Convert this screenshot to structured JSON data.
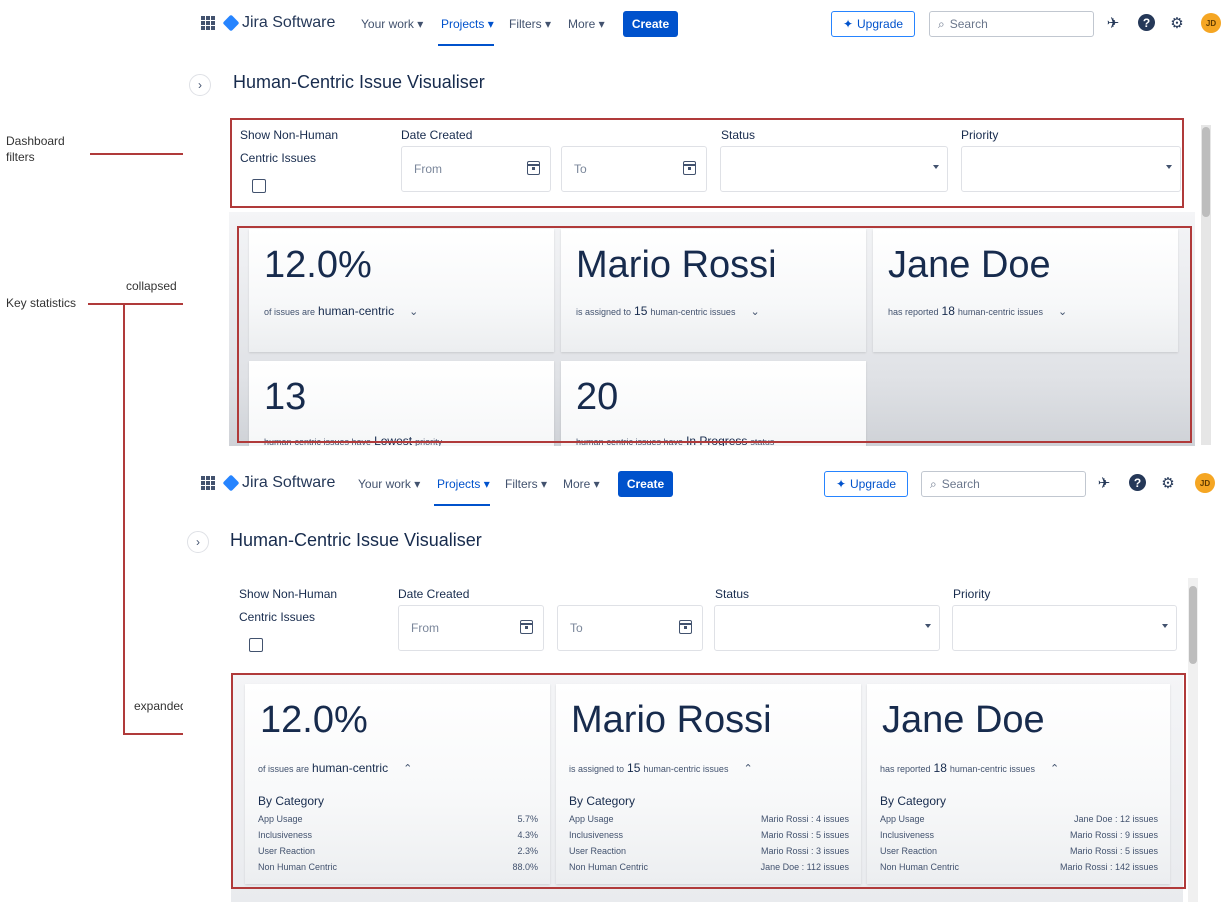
{
  "annotations": {
    "dashboard_filters": [
      "Dashboard",
      "filters"
    ],
    "key_statistics": "Key statistics",
    "collapsed": "collapsed",
    "expanded": "expanded"
  },
  "nav": {
    "product": "Jira Software",
    "items": [
      "Your work",
      "Projects",
      "Filters",
      "More"
    ],
    "create": "Create",
    "upgrade": "Upgrade",
    "search_placeholder": "Search",
    "avatar_initials": "JD"
  },
  "page": {
    "title": "Human-Centric Issue Visualiser"
  },
  "filters": {
    "non_human_label": [
      "Show Non-Human",
      "Centric Issues"
    ],
    "date_label": "Date Created",
    "from": "From",
    "to": "To",
    "status_label": "Status",
    "priority_label": "Priority"
  },
  "collapsed_cards": [
    {
      "big": "12.0%",
      "pre": "of issues are",
      "em": "human-centric",
      "post": ""
    },
    {
      "big": "Mario Rossi",
      "pre": "is assigned to",
      "em": "15",
      "post": "human-centric issues"
    },
    {
      "big": "Jane Doe",
      "pre": "has reported",
      "em": "18",
      "post": "human-centric issues"
    },
    {
      "big": "13",
      "pre": "human-centric issues have",
      "em": "Lowest",
      "post": "priority"
    },
    {
      "big": "20",
      "pre": "human-centric issues have",
      "em": "In Progress",
      "post": "status"
    }
  ],
  "expanded_cards": [
    {
      "big": "12.0%",
      "pre": "of issues are",
      "em": "human-centric",
      "post": "",
      "by_category": "By Category",
      "rows": [
        {
          "label": "App Usage",
          "value": "5.7%"
        },
        {
          "label": "Inclusiveness",
          "value": "4.3%"
        },
        {
          "label": "User Reaction",
          "value": "2.3%"
        },
        {
          "label": "Non Human Centric",
          "value": "88.0%"
        }
      ]
    },
    {
      "big": "Mario Rossi",
      "pre": "is assigned to",
      "em": "15",
      "post": "human-centric issues",
      "by_category": "By Category",
      "rows": [
        {
          "label": "App Usage",
          "value": "Mario Rossi : 4 issues"
        },
        {
          "label": "Inclusiveness",
          "value": "Mario Rossi : 5 issues"
        },
        {
          "label": "User Reaction",
          "value": "Mario Rossi : 3 issues"
        },
        {
          "label": "Non Human Centric",
          "value": "Jane Doe : 112 issues"
        }
      ]
    },
    {
      "big": "Jane Doe",
      "pre": "has reported",
      "em": "18",
      "post": "human-centric issues",
      "by_category": "By Category",
      "rows": [
        {
          "label": "App Usage",
          "value": "Jane Doe : 12 issues"
        },
        {
          "label": "Inclusiveness",
          "value": "Mario Rossi : 9 issues"
        },
        {
          "label": "User Reaction",
          "value": "Mario Rossi : 5 issues"
        },
        {
          "label": "Non Human Centric",
          "value": "Mario Rossi : 142 issues"
        }
      ]
    }
  ],
  "colors": {
    "accent": "#0052cc",
    "annotation": "#b03a3a",
    "avatar": "#f5a623"
  }
}
